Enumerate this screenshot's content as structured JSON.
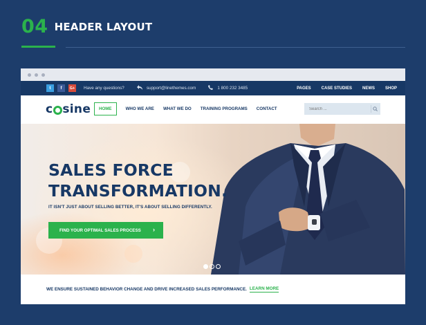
{
  "section": {
    "number": "04",
    "title": "HEADER LAYOUT"
  },
  "topbar": {
    "social": [
      "t",
      "f",
      "G+"
    ],
    "question": "Have any questions?",
    "email": "support@linethemes.com",
    "phone": "1 800 232 3485",
    "nav": [
      "PAGES",
      "CASE STUDIES",
      "NEWS",
      "SHOP"
    ]
  },
  "header": {
    "logo_prefix": "c",
    "logo_suffix": "sine",
    "nav": [
      "HOME",
      "WHO WE ARE",
      "WHAT WE DO",
      "TRAINING PROGRAMS",
      "CONTACT"
    ],
    "active_nav": "HOME",
    "search_placeholder": "Search ..."
  },
  "hero": {
    "title_line1": "SALES FORCE",
    "title_line2": "TRANSFORMATION.",
    "subtitle": "IT ISN'T JUST ABOUT SELLING BETTER, IT'S ABOUT SELLING DIFFERENTLY.",
    "cta_label": "FIND YOUR OPTIMAL SALES PROCESS",
    "cta_arrow": "›",
    "slide_count": 3,
    "active_slide": 1
  },
  "strip": {
    "text": "WE ENSURE SUSTAINED BEHAVIOR CHANGE AND DRIVE INCREASED SALES PERFORMANCE.",
    "link": "LEARN MORE"
  },
  "colors": {
    "navy": "#173865",
    "background": "#1d3d6b",
    "accent_green": "#2bb24c"
  }
}
